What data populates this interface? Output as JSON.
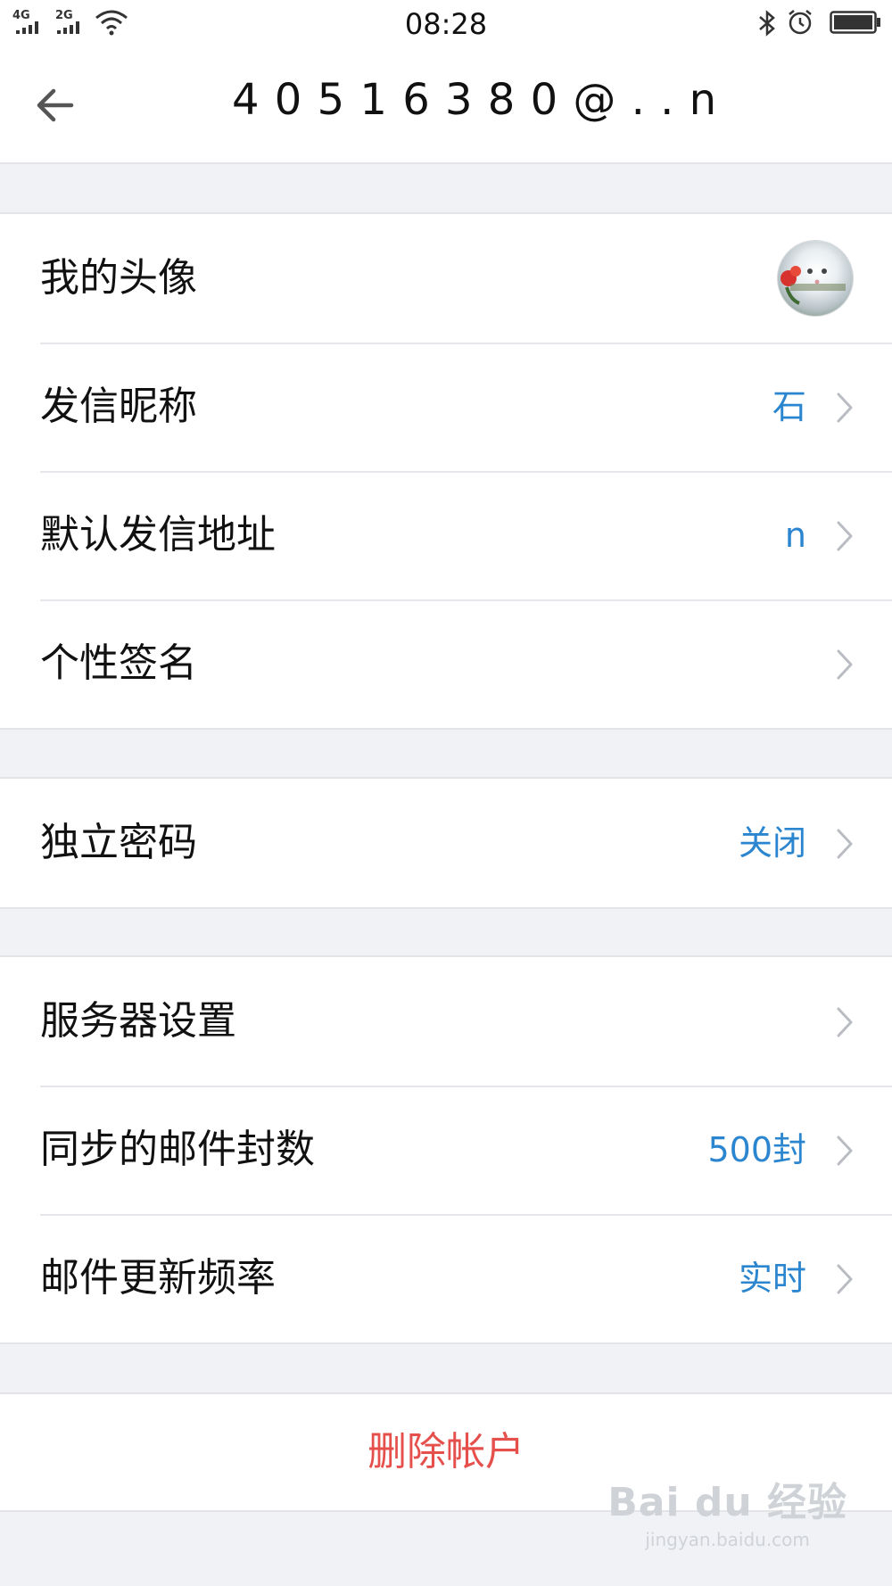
{
  "status_bar": {
    "network_1": "4G",
    "network_2": "2G",
    "time": "08:28"
  },
  "header": {
    "title": "4 0 5 1 6 3 8 0 @ . . n"
  },
  "account_group": {
    "items": [
      {
        "label": "我的头像",
        "value": ""
      },
      {
        "label": "发信昵称",
        "value": "石"
      },
      {
        "label": "默认发信地址",
        "value": "n"
      },
      {
        "label": "个性签名",
        "value": ""
      }
    ]
  },
  "security_group": {
    "items": [
      {
        "label": "独立密码",
        "value": "关闭"
      }
    ]
  },
  "server_group": {
    "items": [
      {
        "label": "服务器设置",
        "value": ""
      },
      {
        "label": "同步的邮件封数",
        "value": "500封"
      },
      {
        "label": "邮件更新频率",
        "value": "实时"
      }
    ]
  },
  "delete_account": {
    "label": "删除帐户"
  },
  "watermark": {
    "logo": "Bai du 经验",
    "url": "jingyan.baidu.com"
  },
  "colors": {
    "value_blue": "#2b86cf",
    "delete_red": "#e5504d",
    "background": "#f1f2f6"
  }
}
